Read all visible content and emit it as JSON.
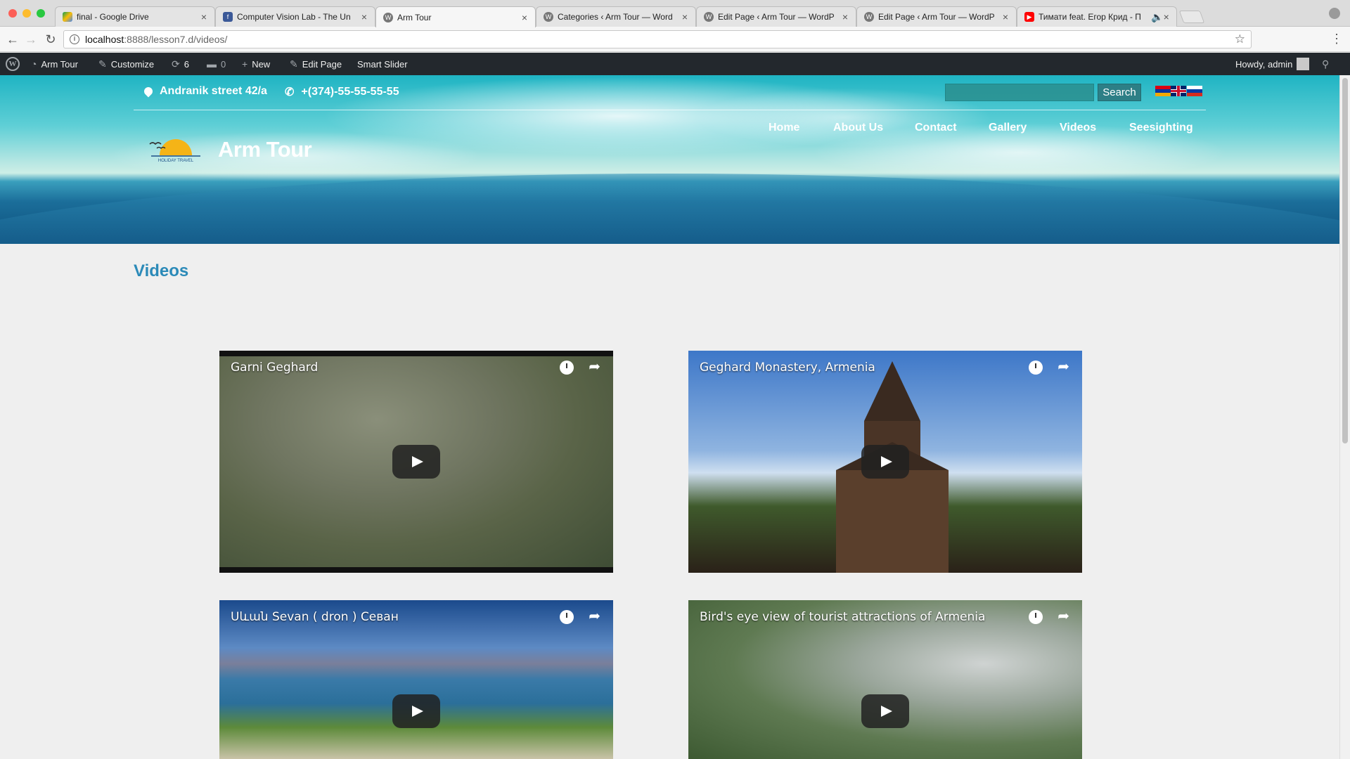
{
  "browser": {
    "tabs": [
      {
        "title": "final - Google Drive",
        "favicon": "google-drive-icon"
      },
      {
        "title": "Computer Vision Lab - The Un",
        "favicon": "facebook-icon"
      },
      {
        "title": "Arm Tour",
        "favicon": "wordpress-icon"
      },
      {
        "title": "Categories ‹ Arm Tour — Word",
        "favicon": "wordpress-icon"
      },
      {
        "title": "Edit Page ‹ Arm Tour — WordP",
        "favicon": "wordpress-icon"
      },
      {
        "title": "Edit Page ‹ Arm Tour — WordP",
        "favicon": "wordpress-icon"
      },
      {
        "title": "Тимати feat. Егор Крид - П",
        "favicon": "youtube-icon"
      }
    ],
    "active_tab": 2,
    "url_host": "localhost",
    "url_path": ":8888/lesson7.d/videos/"
  },
  "admin_bar": {
    "site_name": "Arm Tour",
    "customize": "Customize",
    "updates_count": "6",
    "comments_count": "0",
    "new_label": "New",
    "edit_page": "Edit Page",
    "smart_slider": "Smart Slider",
    "howdy": "Howdy, admin"
  },
  "header": {
    "address": "Andranik street 42/a",
    "phone": "+(374)-55-55-55-55",
    "search_button": "Search",
    "search_placeholder": "",
    "brand": "Arm Tour",
    "logo_text": "HOLIDAY TRAVEL",
    "nav": [
      "Home",
      "About Us",
      "Contact",
      "Gallery",
      "Videos",
      "Seesighting"
    ],
    "languages": [
      "armenian-flag",
      "uk-flag",
      "russian-flag"
    ]
  },
  "page": {
    "title": "Videos",
    "videos": [
      {
        "title": "Garni Geghard"
      },
      {
        "title": "Geghard Monastery, Armenia"
      },
      {
        "title": "Սևան Sevan ( dron ) Севан"
      },
      {
        "title": "Bird's eye view of tourist attractions of Armenia"
      }
    ]
  },
  "colors": {
    "accent": "#2b8ab8",
    "admin_bar": "#23282d",
    "search_button": "#2d7f86"
  }
}
